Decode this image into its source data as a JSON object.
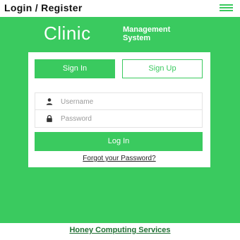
{
  "header": {
    "title": "Login / Register",
    "menu_icon": "hamburger-menu-icon"
  },
  "brand": {
    "name": "Clinic",
    "tagline_line1": "Management",
    "tagline_line2": "System"
  },
  "tabs": {
    "signin_label": "Sign In",
    "signup_label": "Sign Up",
    "active": "Sign In"
  },
  "form": {
    "username_placeholder": "Username",
    "username_value": "",
    "username_icon": "user-icon",
    "password_placeholder": "Password",
    "password_value": "",
    "password_icon": "lock-icon",
    "login_label": "Log In",
    "forgot_label": "Forgot your Password?"
  },
  "footer": {
    "link_label": "Honey Computing Services"
  },
  "colors": {
    "accent": "#3aca5f",
    "background": "#ffffff",
    "footer_link": "#1f6f33"
  }
}
